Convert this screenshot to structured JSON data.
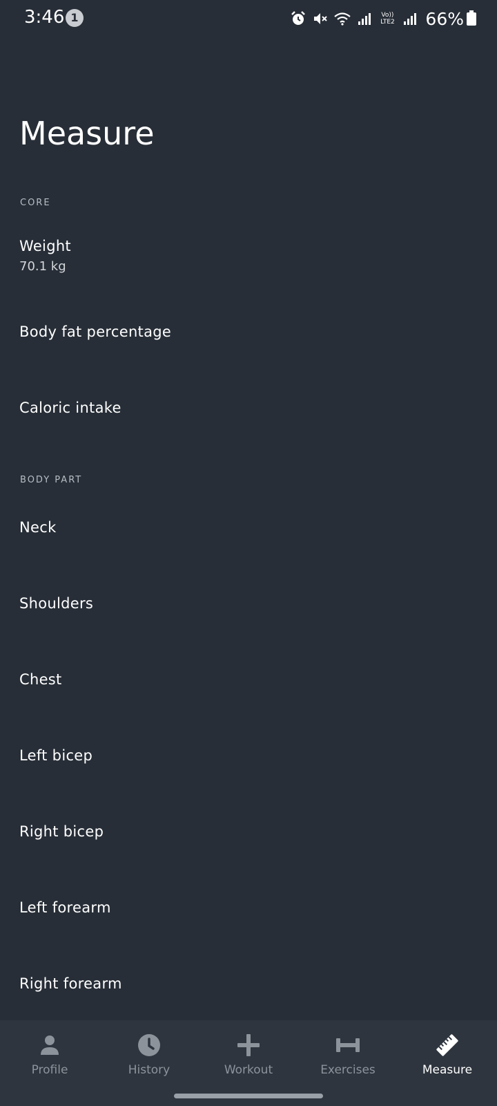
{
  "status_bar": {
    "time": "3:46",
    "notification_count": "1",
    "volte_line1": "Vo))",
    "volte_line2": "LTE2",
    "battery": "66%"
  },
  "page": {
    "title": "Measure"
  },
  "sections": {
    "core": {
      "header": "CORE",
      "items": [
        {
          "label": "Weight",
          "value": "70.1 kg"
        },
        {
          "label": "Body fat percentage"
        },
        {
          "label": "Caloric intake"
        }
      ]
    },
    "body_part": {
      "header": "BODY PART",
      "items": [
        {
          "label": "Neck"
        },
        {
          "label": "Shoulders"
        },
        {
          "label": "Chest"
        },
        {
          "label": "Left bicep"
        },
        {
          "label": "Right bicep"
        },
        {
          "label": "Left forearm"
        },
        {
          "label": "Right forearm"
        }
      ]
    }
  },
  "bottom_nav": {
    "items": [
      {
        "label": "Profile",
        "icon": "person-icon"
      },
      {
        "label": "History",
        "icon": "clock-icon"
      },
      {
        "label": "Workout",
        "icon": "plus-icon"
      },
      {
        "label": "Exercises",
        "icon": "dumbbell-icon"
      },
      {
        "label": "Measure",
        "icon": "ruler-icon",
        "active": true
      }
    ],
    "active_color": "#ffffff",
    "inactive_color": "#8d939b"
  },
  "colors": {
    "background": "#272e37",
    "nav_background": "#2e353e"
  }
}
